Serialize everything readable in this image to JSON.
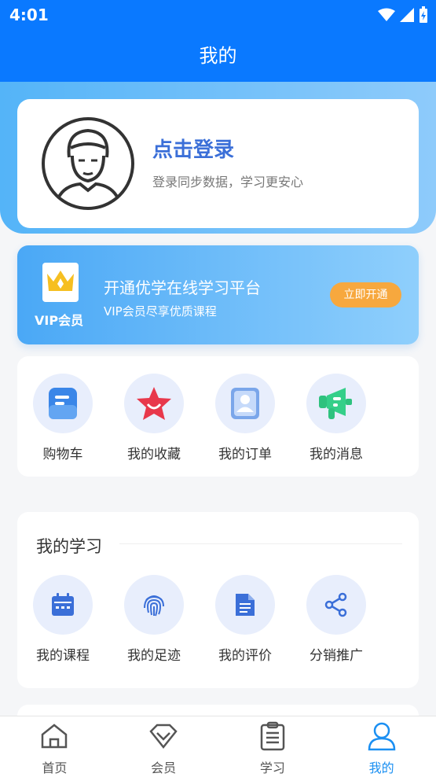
{
  "status_bar": {
    "time": "4:01"
  },
  "header": {
    "title": "我的"
  },
  "login": {
    "title": "点击登录",
    "subtitle": "登录同步数据，学习更安心"
  },
  "vip": {
    "badge_label": "VIP会员",
    "title": "开通优学在线学习平台",
    "subtitle": "VIP会员尽享优质课程",
    "button_label": "立即开通"
  },
  "quick_actions": [
    {
      "label": "购物车",
      "icon": "cart-icon"
    },
    {
      "label": "我的收藏",
      "icon": "star-icon"
    },
    {
      "label": "我的订单",
      "icon": "order-icon"
    },
    {
      "label": "我的消息",
      "icon": "megaphone-icon"
    }
  ],
  "study": {
    "title": "我的学习",
    "items": [
      {
        "label": "我的课程",
        "icon": "calendar-icon"
      },
      {
        "label": "我的足迹",
        "icon": "fingerprint-icon"
      },
      {
        "label": "我的评价",
        "icon": "document-icon"
      },
      {
        "label": "分销推广",
        "icon": "share-icon"
      }
    ]
  },
  "bottom_nav": [
    {
      "label": "首页",
      "icon": "home-icon"
    },
    {
      "label": "会员",
      "icon": "diamond-icon"
    },
    {
      "label": "学习",
      "icon": "clipboard-icon"
    },
    {
      "label": "我的",
      "icon": "user-icon",
      "active": true
    }
  ],
  "colors": {
    "primary": "#0a79ff",
    "accent_blue": "#3b6fd8",
    "vip_button": "#f7a83e",
    "nav_active": "#1a8ff2"
  }
}
